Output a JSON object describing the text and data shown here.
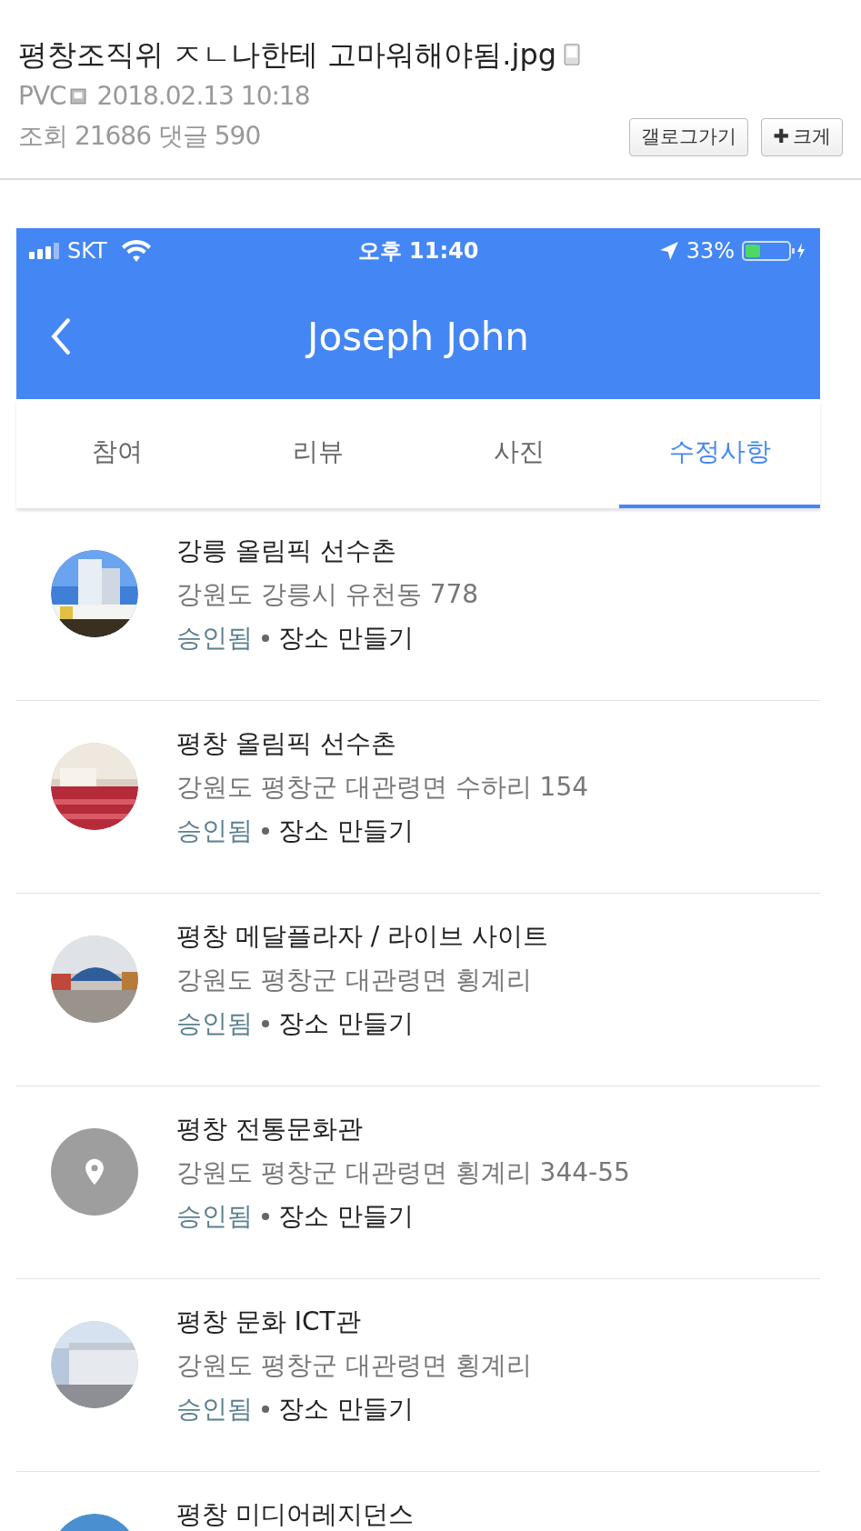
{
  "post": {
    "title": "평창조직위 ㅈㄴ나한테 고마워해야됨.jpg",
    "author": "PVC",
    "date": "2018.02.13 10:18",
    "stats": "조회 21686 댓글 590",
    "buttons": [
      {
        "kind": "plain",
        "label": "갤로그가기"
      },
      {
        "kind": "plus",
        "icon": "✚",
        "label": "크게"
      }
    ]
  },
  "phone": {
    "status_bar": {
      "carrier": "SKT",
      "time": "오후 11:40",
      "battery": "33%"
    },
    "header": {
      "title": "Joseph John"
    },
    "tabs": [
      {
        "label": "참여",
        "selected": false
      },
      {
        "label": "리뷰",
        "selected": false
      },
      {
        "label": "사진",
        "selected": false
      },
      {
        "label": "수정사항",
        "selected": true
      }
    ],
    "places": [
      {
        "name": "강릉 올림픽 선수촌",
        "address": "강원도 강릉시 유천동 778",
        "status": "승인됨",
        "action": "장소 만들기",
        "kind": "picture"
      },
      {
        "name": "평창 올림픽 선수촌",
        "address": "강원도 평창군 대관령면 수하리 154",
        "status": "승인됨",
        "action": "장소 만들기",
        "kind": "picture"
      },
      {
        "name": "평창 메달플라자 / 라이브 사이트",
        "address": "강원도 평창군 대관령면 횡계리",
        "status": "승인됨",
        "action": "장소 만들기",
        "kind": "picture"
      },
      {
        "name": "평창 전통문화관",
        "address": "강원도 평창군 대관령면 횡계리 344-55",
        "status": "승인됨",
        "action": "장소 만들기",
        "kind": "pin"
      },
      {
        "name": "평창 문화 ICT관",
        "address": "강원도 평창군 대관령면 횡계리",
        "status": "승인됨",
        "action": "장소 만들기",
        "kind": "picture"
      },
      {
        "name": "평창 미디어레지던스",
        "kind": "picture"
      }
    ]
  }
}
